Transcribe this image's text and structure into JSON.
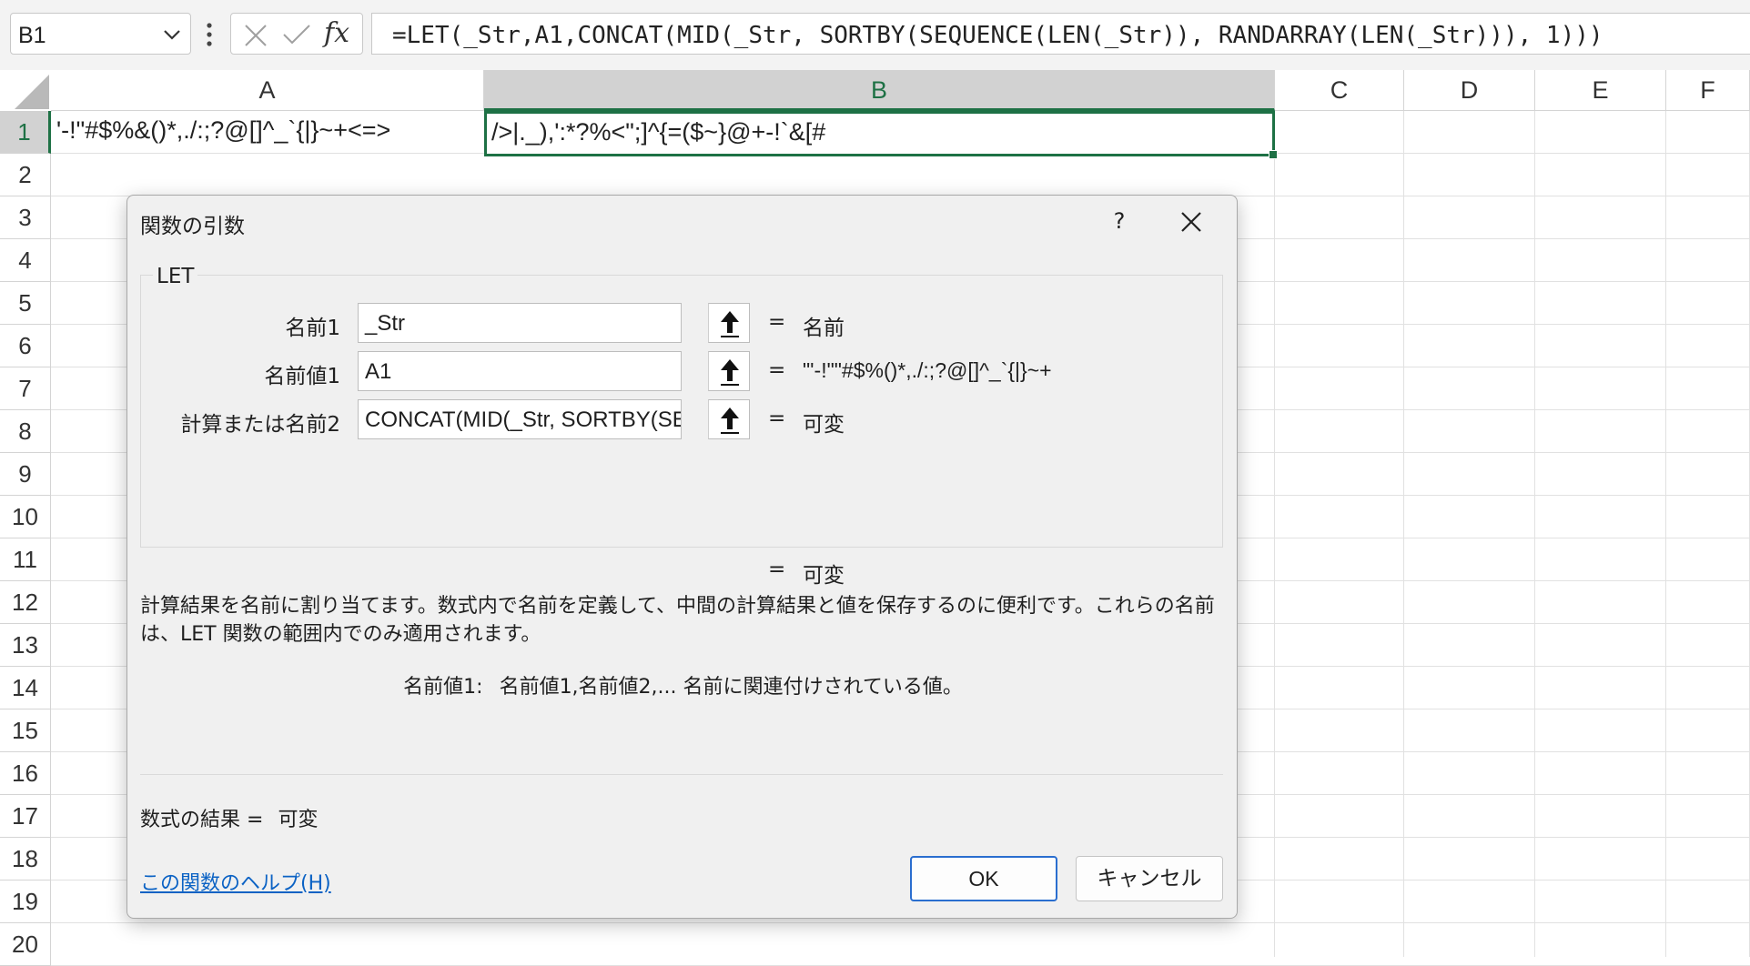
{
  "formula_bar": {
    "name_box": "B1",
    "formula": "=LET(_Str,A1,CONCAT(MID(_Str, SORTBY(SEQUENCE(LEN(_Str)), RANDARRAY(LEN(_Str))), 1)))"
  },
  "columns": [
    "A",
    "B",
    "C",
    "D",
    "E",
    "F"
  ],
  "rows": [
    "1",
    "2",
    "3",
    "4",
    "5",
    "6",
    "7",
    "8",
    "9",
    "10",
    "11",
    "12",
    "13",
    "14",
    "15",
    "16",
    "17",
    "18",
    "19",
    "20"
  ],
  "cells": {
    "A1": "'-!\"#$%&()*,./:;?@[]^_`{|}~+<=>",
    "B1": "/>|._),':*?%<\";]^{=($~}@+-!`&[#"
  },
  "dialog": {
    "title": "関数の引数",
    "help": "?",
    "function_name": "LET",
    "args": [
      {
        "label": "名前1",
        "value": "_Str",
        "result": "名前"
      },
      {
        "label": "名前値1",
        "value": "A1",
        "result": "\"'-!\"\"#$%()*,./:;?@[]^_`{|}~+"
      },
      {
        "label": "計算または名前2",
        "value": "CONCAT(MID(_Str, SORTBY(SE",
        "result": "可変"
      }
    ],
    "equals": "=",
    "total_result": "可変",
    "description": "計算結果を名前に割り当てます。数式内で名前を定義して、中間の計算結果と値を保存するのに便利です。これらの名前は、LET 関数の範囲内でのみ適用されます。",
    "arg_desc_name": "名前値1:",
    "arg_desc_text": "名前値1,名前値2,... 名前に関連付けされている値。",
    "formula_result_label": "数式の結果 =",
    "formula_result_value": "可変",
    "help_link": "この関数のヘルプ(H)",
    "ok": "OK",
    "cancel": "キャンセル"
  },
  "colors": {
    "accent_green": "#1e7145",
    "link_blue": "#0b62c4",
    "ok_border": "#2a6ecf"
  }
}
